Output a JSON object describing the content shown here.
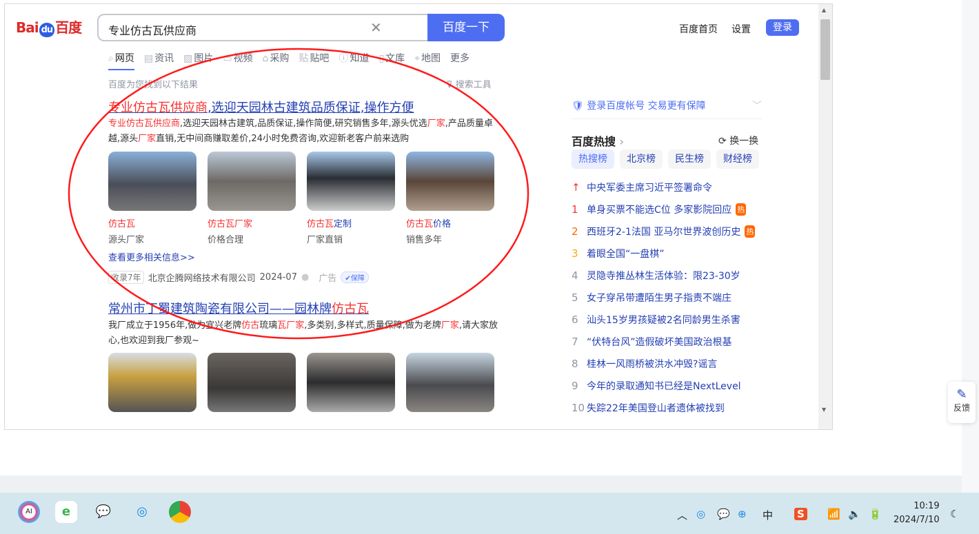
{
  "header": {
    "logo": "Baidu百度",
    "query": "专业仿古瓦供应商",
    "search_button": "百度一下",
    "links": [
      "百度首页",
      "设置"
    ],
    "login": "登录"
  },
  "tabs": [
    "网页",
    "资讯",
    "图片",
    "视频",
    "采购",
    "贴吧",
    "知道",
    "文库",
    "地图",
    "更多"
  ],
  "found_text": "百度为您找到以下结果",
  "search_tools": "搜索工具",
  "result1": {
    "title_em": "专业仿古瓦供应商",
    "title_rest": ",选迎天园林古建筑品质保证,操作方便",
    "desc": [
      {
        "t": "专业仿古瓦供应商",
        "em": true
      },
      {
        "t": ",选迎天园林古建筑,品质保证,操作简便,研究销售多年,源头优选"
      },
      {
        "t": "厂家",
        "em": true
      },
      {
        "t": ",产品质量卓越,源头"
      },
      {
        "t": "厂家",
        "em": true
      },
      {
        "t": "直销,无中间商赚取差价,24小时免费咨询,欢迎新老客户前来选购"
      }
    ],
    "cards": [
      {
        "em": "仿古瓦",
        "rest": "",
        "sub": "源头厂家"
      },
      {
        "em": "仿古瓦厂家",
        "rest": "",
        "sub": "价格合理"
      },
      {
        "em": "仿古瓦",
        "rest": "定制",
        "sub": "厂家直销"
      },
      {
        "em": "仿古瓦",
        "rest": "价格",
        "sub": "销售多年"
      }
    ],
    "more": "查看更多相关信息>>",
    "badge": "收录7年",
    "company": "北京企腾网络技术有限公司",
    "date": "2024-07",
    "ad": "广告",
    "guarantee": "保障"
  },
  "result2": {
    "title_rest": "常州市丁蜀建筑陶瓷有限公司——园林牌",
    "title_em": "仿古瓦",
    "desc": [
      {
        "t": "我厂成立于1956年,做为宜兴老牌"
      },
      {
        "t": "仿古",
        "em": true
      },
      {
        "t": "琉璃"
      },
      {
        "t": "瓦厂家",
        "em": true
      },
      {
        "t": ",多类别,多样式,质量保障,做为老牌"
      },
      {
        "t": "厂家",
        "em": true
      },
      {
        "t": ",请大家放心,也欢迎到我厂参观~"
      }
    ]
  },
  "sidebar": {
    "login_tip": "登录百度帐号 交易更有保障",
    "hot_title": "百度热搜",
    "refresh": "换一换",
    "pills": [
      "热搜榜",
      "北京榜",
      "民生榜",
      "财经榜"
    ],
    "items": [
      {
        "n": "↑",
        "t": "中央军委主席习近平签署命令",
        "c": "#f73131"
      },
      {
        "n": "1",
        "t": "单身买票不能选C位 多家影院回应",
        "c": "#f73131",
        "hot": "热"
      },
      {
        "n": "2",
        "t": "西班牙2-1法国 亚马尔世界波创历史",
        "c": "#ff6600",
        "hot": "热"
      },
      {
        "n": "3",
        "t": "着眼全国“一盘棋”",
        "c": "#faa90e"
      },
      {
        "n": "4",
        "t": "灵隐寺推丛林生活体验：限23-30岁"
      },
      {
        "n": "5",
        "t": "女子穿吊带遭陌生男子指责不端庄"
      },
      {
        "n": "6",
        "t": "汕头15岁男孩疑被2名同龄男生杀害"
      },
      {
        "n": "7",
        "t": "“伏特台风”造假破坏美国政治根基"
      },
      {
        "n": "8",
        "t": "桂林一风雨桥被洪水冲毁?谣言"
      },
      {
        "n": "9",
        "t": "今年的录取通知书已经是NextLevel"
      },
      {
        "n": "10",
        "t": "失踪22年美国登山者遗体被找到"
      }
    ]
  },
  "feedback": "反馈",
  "taskbar": {
    "ime": "中",
    "time": "10:19",
    "date": "2024/7/10"
  },
  "colors": {
    "accent": "#4e6ef2",
    "link": "#2440b3",
    "highlight": "#f73131",
    "annotation": "#ff1a1a"
  }
}
